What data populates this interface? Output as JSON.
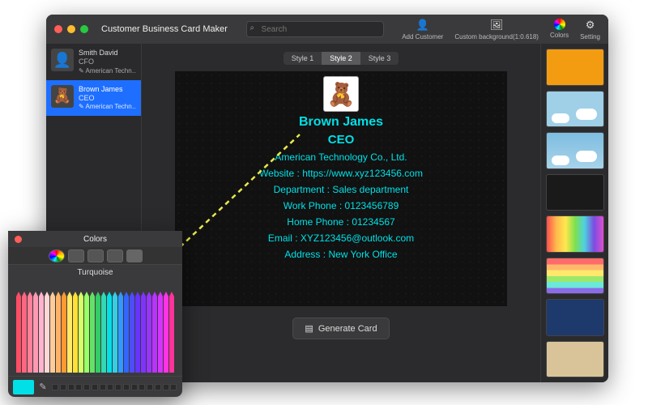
{
  "app": {
    "title": "Customer Business Card Maker"
  },
  "search": {
    "placeholder": "Search"
  },
  "toolbar": {
    "add_customer": "Add Customer",
    "custom_bg": "Custom background(1:0.618)",
    "colors": "Colors",
    "setting": "Setting"
  },
  "customers": [
    {
      "name": "Smith David",
      "role": "CFO",
      "company": "American Technology C",
      "avatar_emoji": "👤",
      "active": false
    },
    {
      "name": "Brown James",
      "role": "CEO",
      "company": "American Technology C",
      "avatar_emoji": "🧸",
      "active": true
    }
  ],
  "style_tabs": {
    "items": [
      "Style 1",
      "Style 2",
      "Style 3"
    ],
    "active_index": 1
  },
  "card": {
    "avatar_emoji": "🧸",
    "name": "Brown James",
    "role": "CEO",
    "company": "American Technology Co., Ltd.",
    "website_label": "Website : ",
    "website": "https://www.xyz123456.com",
    "department_label": "Department : ",
    "department": "Sales department",
    "work_phone_label": "Work Phone : ",
    "work_phone": "0123456789",
    "home_phone_label": "Home Phone : ",
    "home_phone": "01234567",
    "email_label": "Email : ",
    "email": "XYZ123456@outlook.com",
    "address_label": "Address : ",
    "address": "New York Office",
    "text_color": "#00e0e6"
  },
  "generate_label": "Generate Card",
  "backgrounds": [
    {
      "style": "background:#f39c12;"
    },
    {
      "style": "background:linear-gradient(#9fd0e8 55%, #9fd0e8 55%), #9fd0e8; position:relative;",
      "clouds": true
    },
    {
      "style": "background:linear-gradient(180deg,#7fbde0,#a7d3ea);",
      "clouds2": true
    },
    {
      "style": "background:#1a1a1a url('data:image/svg+xml;utf8,<svg xmlns=\"http://www.w3.org/2000/svg\"/>');"
    },
    {
      "style": "background:linear-gradient(90deg,#ff4d4d,#ffb84d,#ffe84d,#7ee04d,#4dd2e0,#7a4de0,#e04dd2);"
    },
    {
      "style": "background:linear-gradient(180deg,#ff6b6b 0 17%,#ffb86b 17% 34%,#ffe86b 34% 51%,#9be86b 51% 68%,#6be8d8 68% 85%,#8b6be8 85% 100%);"
    },
    {
      "style": "background:#1e3a6d;"
    },
    {
      "style": "background:#d9c49a;"
    }
  ],
  "colors_panel": {
    "title": "Colors",
    "selected_name": "Turquoise",
    "selected_hex": "#00e0e6",
    "pencil_colors_back": [
      "#4a2b1a",
      "#6a4a2a",
      "#8a6a3a",
      "#a08a5a",
      "#c0a878",
      "#d8c89a",
      "#e8dcba",
      "#f0ead6",
      "#f5efe0",
      "#f8f4ea",
      "#d8cfa8",
      "#bfb480",
      "#a69958",
      "#8c7e40",
      "#726530",
      "#5a4d22",
      "#423816",
      "#2c250e",
      "#1a1508",
      "#0d0a04",
      "#c0c0c0",
      "#a0a0a0",
      "#808080",
      "#606060",
      "#404040",
      "#2a2a2a",
      "#181818",
      "#0a0a0a"
    ],
    "pencil_colors_front": [
      "#ff4d66",
      "#ff6680",
      "#ff8099",
      "#ff99b3",
      "#ffb3cc",
      "#ffd6d6",
      "#ffcc99",
      "#ffb366",
      "#ff9933",
      "#ffeb66",
      "#ffe033",
      "#d6ff66",
      "#99ff66",
      "#66e066",
      "#33cc66",
      "#33d9b3",
      "#00e0e6",
      "#33cfe6",
      "#3399ff",
      "#3366ff",
      "#4d4dff",
      "#6633ff",
      "#8033ff",
      "#9933ff",
      "#b833ff",
      "#d633ff",
      "#ff33e6",
      "#ff3399"
    ]
  }
}
